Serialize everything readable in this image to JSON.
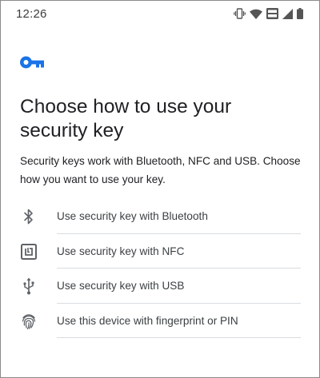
{
  "status_bar": {
    "time": "12:26",
    "icons": [
      "vibrate-icon",
      "wifi-icon",
      "volte-icon",
      "cell-signal-icon",
      "battery-icon"
    ]
  },
  "colors": {
    "accent": "#1a73e8",
    "text_primary": "#202124",
    "text_secondary": "#3c4043",
    "icon_gray": "#5f6368",
    "divider": "#dadce0"
  },
  "header": {
    "logo_icon": "key-icon",
    "title": "Choose how to use your security key"
  },
  "description": "Security keys work with Bluetooth, NFC and USB. Choose how you want to use your key.",
  "options": [
    {
      "icon": "bluetooth-icon",
      "label": "Use security key with Bluetooth"
    },
    {
      "icon": "nfc-icon",
      "label": "Use security key with NFC"
    },
    {
      "icon": "usb-icon",
      "label": "Use security key with USB"
    },
    {
      "icon": "fingerprint-icon",
      "label": "Use this device with fingerprint or PIN"
    }
  ]
}
